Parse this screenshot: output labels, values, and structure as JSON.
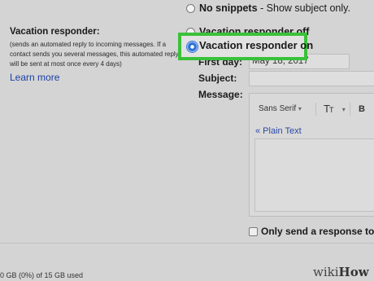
{
  "snippets": {
    "label": "No snippets",
    "sub": " - Show subject only."
  },
  "vacation": {
    "title": "Vacation responder:",
    "description": "(sends an automated reply to incoming messages. If a contact sends you several messages, this automated reply will be sent at most once every 4 days)",
    "learn_more": "Learn more",
    "off_label": "Vacation responder off",
    "on_label": "Vacation responder on"
  },
  "form": {
    "first_day_label": "First day:",
    "first_day_value": "May 18, 2017",
    "subject_label": "Subject:",
    "subject_value": "",
    "message_label": "Message:"
  },
  "editor": {
    "font": "Sans Serif",
    "size_icon": "text-size-icon",
    "bold": "B",
    "plain_text": "« Plain Text"
  },
  "only_send": "Only send a response to",
  "storage": "0 GB (0%) of 15 GB used",
  "watermark": {
    "part1": "wiki",
    "part2": "How"
  },
  "colors": {
    "highlight": "#3ac13a",
    "link": "#1a3fa6",
    "radio_selected": "#2f6fd6"
  }
}
